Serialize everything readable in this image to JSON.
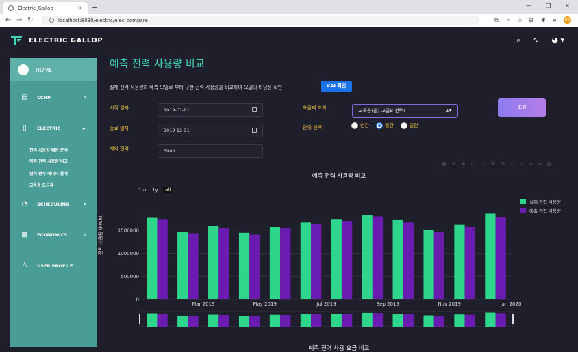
{
  "browser": {
    "tab_title": "Electric_Gallop",
    "url": "localhost:8080/electric/elec_compare",
    "profile_initials": "HB"
  },
  "header": {
    "brand": "ELECTRIC GALLOP"
  },
  "sidebar": {
    "home": "HOME",
    "items": [
      {
        "label": "CCHP"
      },
      {
        "label": "ELECTRIC"
      },
      {
        "label": "SCHEDULING"
      },
      {
        "label": "ECONOMICS"
      },
      {
        "label": "USER PROFILE"
      }
    ],
    "subitems": [
      "전력 사용량 패턴 분석",
      "예측 전력 사용량 비교",
      "입력 변수 데이터 통계",
      "교육용 요금제"
    ]
  },
  "main": {
    "title": "예측 전력 사용량 비교",
    "description": "실제 전력 사용량과 예측 모델로 부터 구한 전력 사용량을 비교하여 모델의 타당성 확인",
    "xai_button": "XAI 확인",
    "start_label": "시작 일자",
    "start_value": "2019-01-01",
    "end_label": "종료 일자",
    "end_value": "2019-12-31",
    "contract_label": "계약 전력",
    "contract_value": "3000",
    "rate_label": "요금제 조회",
    "rate_value": "교육용(을) 고압B 선택I",
    "unit_label": "단위 선택",
    "unit_options": [
      "연간",
      "월간",
      "일간"
    ],
    "unit_selected": "월간",
    "query_button": "조회",
    "bottom_chart_title": "예측 전력 사용 요금 비교"
  },
  "colors": {
    "actual": "#2dd68a",
    "predicted": "#6a1bb0",
    "accent": "#3fd7b7"
  },
  "chart_data": {
    "type": "bar",
    "title": "예측 전력 사용량 비교",
    "ylabel": "전력 사용량 (kWh)",
    "range_buttons": [
      "1m",
      "1y",
      "all"
    ],
    "ylim": [
      0,
      2000000
    ],
    "yticks": [
      0,
      500000,
      1000000,
      1500000
    ],
    "ytick_labels": [
      "0",
      "500000",
      "1000000",
      "1500000"
    ],
    "xtick_labels": [
      "Mar 2019",
      "May 2019",
      "Jul 2019",
      "Sep 2019",
      "Nov 2019",
      "Jan 2020"
    ],
    "xtick_index": [
      2,
      4,
      6,
      8,
      10,
      12
    ],
    "categories": [
      "2019-01",
      "2019-02",
      "2019-03",
      "2019-04",
      "2019-05",
      "2019-06",
      "2019-07",
      "2019-08",
      "2019-09",
      "2019-10",
      "2019-11",
      "2019-12"
    ],
    "series": [
      {
        "name": "실제 전력 사용량",
        "values": [
          1770000,
          1460000,
          1590000,
          1440000,
          1570000,
          1670000,
          1730000,
          1830000,
          1720000,
          1500000,
          1620000,
          1860000
        ]
      },
      {
        "name": "예측 전력 사용량",
        "values": [
          1730000,
          1430000,
          1540000,
          1400000,
          1540000,
          1640000,
          1700000,
          1800000,
          1670000,
          1460000,
          1570000,
          1790000
        ]
      }
    ],
    "legend": "top-right"
  }
}
